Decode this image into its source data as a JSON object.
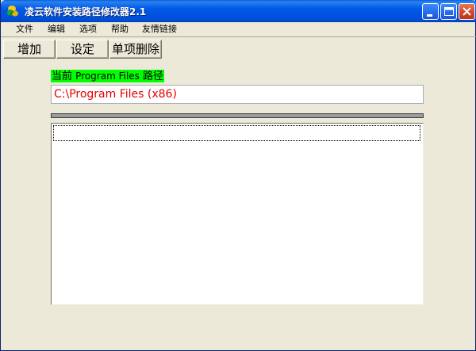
{
  "window": {
    "title": "凌云软件安装路径修改器2.1",
    "icon": "app-leaf-icon"
  },
  "menu": {
    "items": [
      "文件",
      "编辑",
      "选项",
      "帮助",
      "友情链接"
    ]
  },
  "toolbar": {
    "add_label": "增加",
    "set_label": "设定",
    "delete_label": "单项删除"
  },
  "path_label": {
    "prefix": "当前 ",
    "middle": "Program Files",
    "suffix": " 路径",
    "highlight_color": "#00ff00"
  },
  "path_field": {
    "value": "C:\\Program Files (x86)",
    "text_color": "#e60000"
  },
  "list": {
    "items": []
  },
  "title_buttons": [
    "minimize-icon",
    "maximize-icon",
    "close-icon"
  ]
}
